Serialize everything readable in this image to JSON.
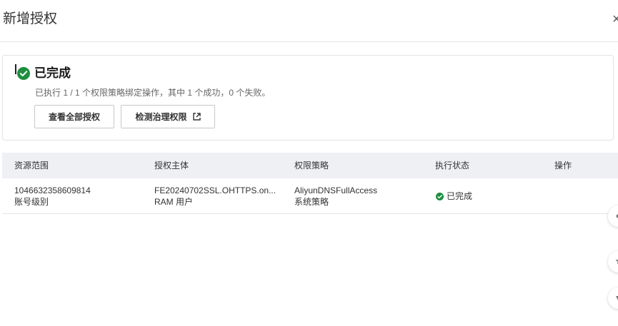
{
  "header": {
    "title": "新增授权",
    "close_label": "×"
  },
  "result": {
    "status_title": "已完成",
    "description": "已执行 1 / 1 个权限策略绑定操作，其中 1 个成功，0 个失败。",
    "buttons": {
      "view_all": "查看全部授权",
      "check_governance": "检测治理权限"
    },
    "status_color": "#1e8e3e"
  },
  "table": {
    "columns": [
      "资源范围",
      "授权主体",
      "权限策略",
      "执行状态",
      "操作"
    ],
    "rows": [
      {
        "scope_id": "1046632358609814",
        "scope_level": "账号级别",
        "principal_name": "FE20240702SSL.OHTTPS.on...",
        "principal_type": "RAM 用户",
        "policy_name": "AliyunDNSFullAccess",
        "policy_type": "系统策略",
        "status": "已完成",
        "action": ""
      }
    ]
  },
  "side_tools": {
    "icons": [
      "float-tool-1-icon",
      "float-tool-2-icon",
      "float-tool-3-icon"
    ]
  }
}
